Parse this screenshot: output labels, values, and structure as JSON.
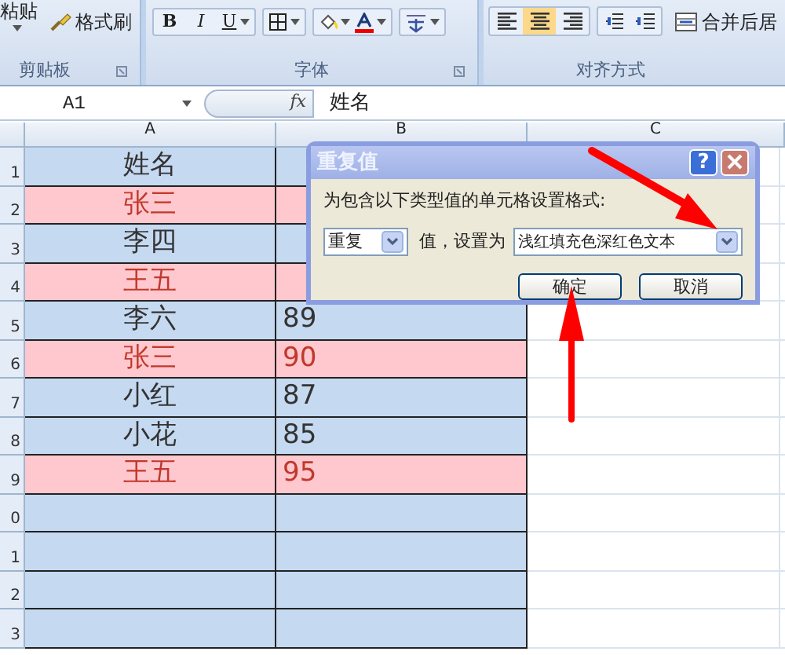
{
  "ribbon": {
    "clipboard": {
      "paste": "粘贴",
      "format_painter": "格式刷",
      "label": "剪贴板"
    },
    "font": {
      "bold": "B",
      "italic": "I",
      "underline": "U",
      "label": "字体"
    },
    "alignment": {
      "buttons": [
        {
          "kind": "left",
          "selected": false
        },
        {
          "kind": "center",
          "selected": true
        },
        {
          "kind": "right",
          "selected": false
        }
      ],
      "merge": "合并后居",
      "label": "对齐方式"
    }
  },
  "formula_bar": {
    "name_box": "A1",
    "fx": "fx",
    "content": "姓名"
  },
  "columns": [
    "A",
    "B",
    "C"
  ],
  "rows": [
    {
      "number": "1",
      "name": "姓名",
      "duplicate": false
    },
    {
      "number": "2",
      "name": "张三",
      "duplicate": true
    },
    {
      "number": "3",
      "name": "李四",
      "duplicate": false
    },
    {
      "number": "4",
      "name": "王五",
      "duplicate": true
    },
    {
      "number": "5",
      "name": "李六",
      "score": "89",
      "duplicate": false
    },
    {
      "number": "6",
      "name": "张三",
      "score": "90",
      "duplicate": true
    },
    {
      "number": "7",
      "name": "小红",
      "score": "87",
      "duplicate": false
    },
    {
      "number": "8",
      "name": "小花",
      "score": "85",
      "duplicate": false
    },
    {
      "number": "9",
      "name": "王五",
      "score": "95",
      "duplicate": true
    },
    {
      "number": "0",
      "duplicate": false
    },
    {
      "number": "1",
      "duplicate": false
    },
    {
      "number": "2",
      "duplicate": false
    },
    {
      "number": "3",
      "duplicate": false
    }
  ],
  "dialog": {
    "title": "重复值",
    "help": "?",
    "prompt": "为包含以下类型值的单元格设置格式:",
    "type_value": "重复",
    "middle_label": "值，设置为",
    "format_value": "浅红填充色深红色文本",
    "ok": "确定",
    "cancel": "取消"
  }
}
